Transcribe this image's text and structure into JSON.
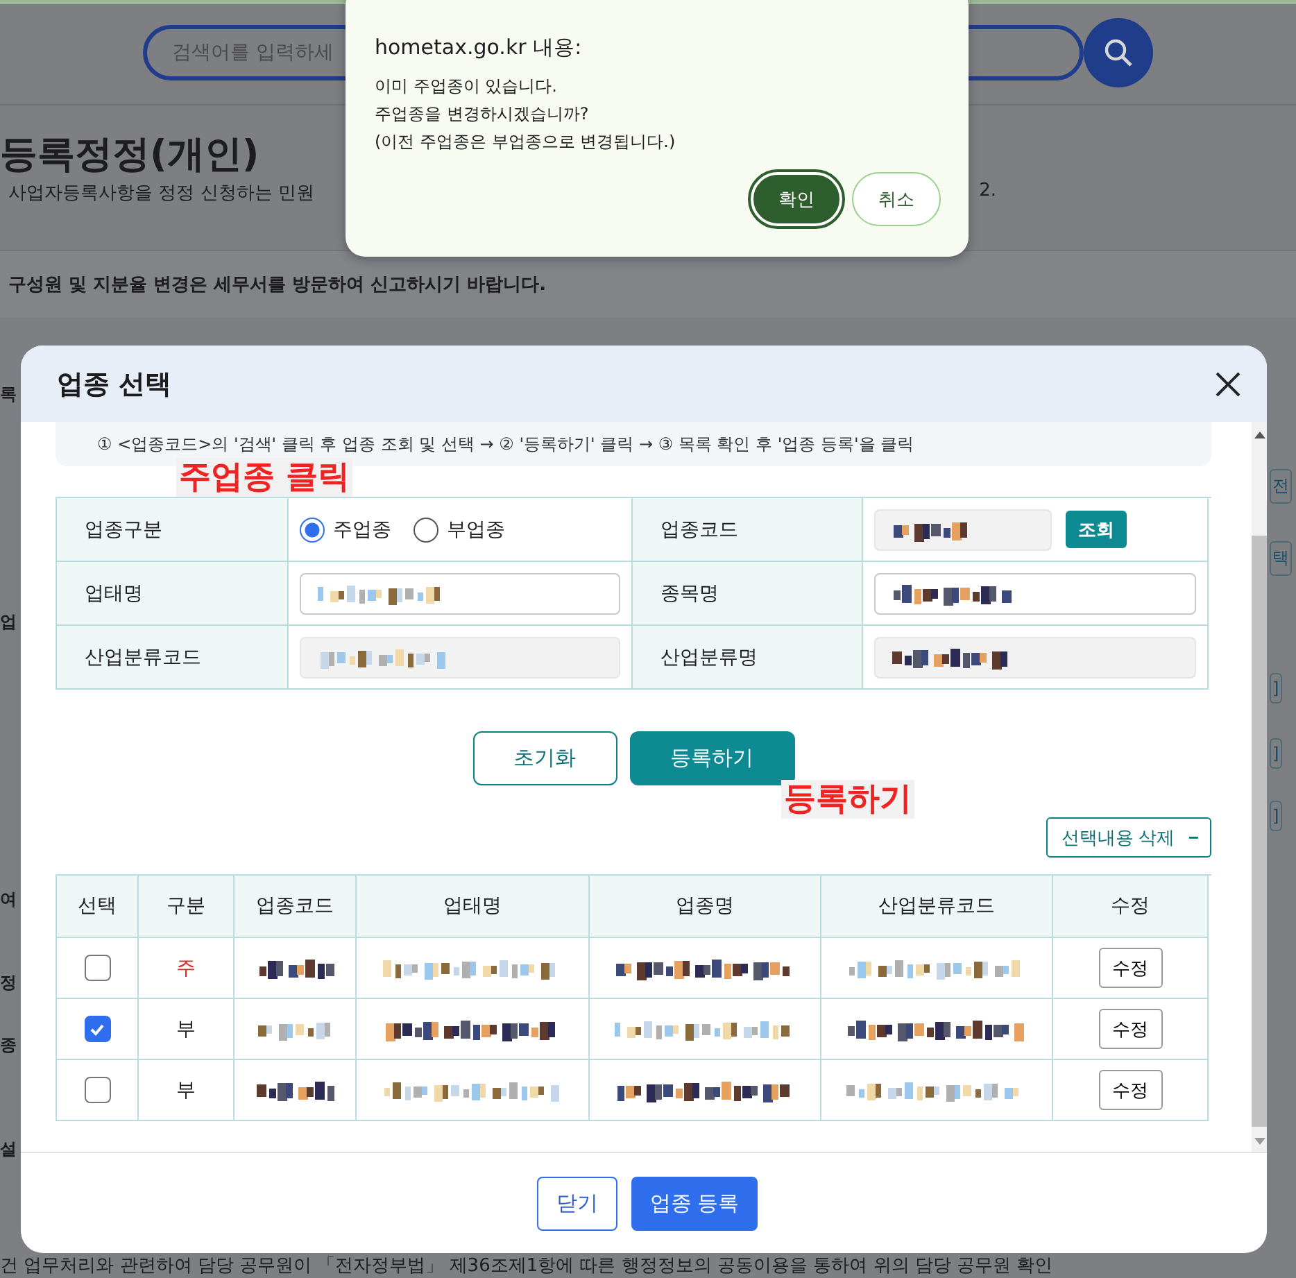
{
  "background_page": {
    "search": {
      "placeholder": "검색어를 입력하세"
    },
    "title": "등록정정(개인)",
    "subtitle": "사업자등록사항을 정정 신청하는 민원",
    "subtitle_end": "2.",
    "notice": "구성원 및 지분율 변경은 세무서를 방문하여 신고하시기 바랍니다.",
    "side_labels": [
      "록",
      "업",
      "여",
      "정",
      "종",
      "설"
    ],
    "right_labels": [
      "전",
      "택",
      "]",
      "]",
      "]"
    ],
    "footer_text": "건 업무처리와 관련하여 담당 공무원이 「전자정부법」 제36조제1항에 따른 행정정보의 공동이용을 통하여 위의 담당 공무원 확인"
  },
  "modal": {
    "title": "업종 선택",
    "instructions": "① <업종코드>의 '검색' 클릭 후 업종 조회 및 선택 → ② '등록하기' 클릭 → ③ 목록 확인 후 '업종 등록'을 클릭",
    "form_annotation": "주업종 클릭",
    "form": {
      "fields": [
        {
          "label": "업종구분",
          "kind": "radio",
          "options": [
            {
              "label": "주업종",
              "selected": true
            },
            {
              "label": "부업종",
              "selected": false
            }
          ]
        },
        {
          "label": "업종코드",
          "kind": "code_search",
          "button": "조회",
          "readonly": true
        },
        {
          "label": "업태명",
          "kind": "text",
          "readonly": false
        },
        {
          "label": "종목명",
          "kind": "text",
          "readonly": false
        },
        {
          "label": "산업분류코드",
          "kind": "text",
          "readonly": true
        },
        {
          "label": "산업분류명",
          "kind": "text",
          "readonly": true
        }
      ]
    },
    "actions": [
      {
        "label": "초기화",
        "kind": "outline"
      },
      {
        "label": "등록하기",
        "kind": "primary"
      }
    ],
    "actions_annotation": "등록하기",
    "delete_button": {
      "label": "선택내용 삭제",
      "icon": "−"
    },
    "table": {
      "columns": [
        "선택",
        "구분",
        "업종코드",
        "업태명",
        "업종명",
        "산업분류코드",
        "수정"
      ],
      "rows": [
        {
          "checked": false,
          "kind": "main",
          "type": "주",
          "button": "수정"
        },
        {
          "checked": true,
          "kind": "sub",
          "type": "부",
          "button": "수정"
        },
        {
          "checked": false,
          "kind": "sub",
          "type": "부",
          "button": "수정"
        }
      ]
    },
    "footer_buttons": [
      {
        "label": "닫기",
        "kind": "outline"
      },
      {
        "label": "업종 등록",
        "kind": "primary"
      }
    ]
  },
  "alert": {
    "title": "hometax.go.kr 내용:",
    "message": [
      "이미 주업종이 있습니다.",
      "주업종을 변경하시겠습니까?",
      "(이전 주업종은 부업종으로 변경됩니다.)"
    ],
    "buttons": [
      {
        "label": "확인",
        "kind": "primary"
      },
      {
        "label": "취소",
        "kind": "secondary"
      }
    ]
  }
}
